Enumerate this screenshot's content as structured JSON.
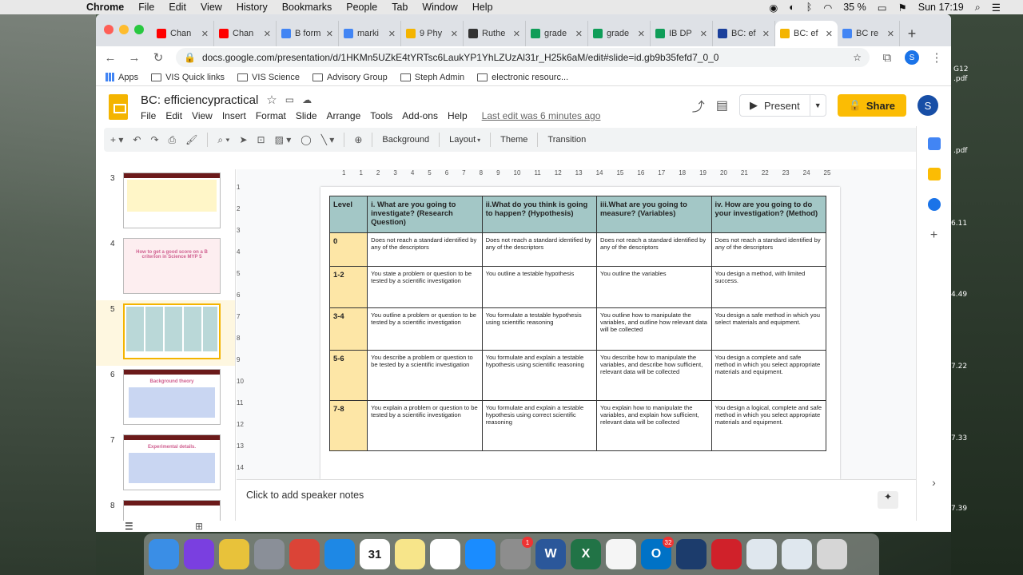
{
  "menubar": {
    "app": "Chrome",
    "items": [
      "File",
      "Edit",
      "View",
      "History",
      "Bookmarks",
      "People",
      "Tab",
      "Window",
      "Help"
    ],
    "battery": "35 %",
    "clock": "Sun 17:19"
  },
  "tabs": [
    {
      "title": "Chan",
      "color": "#ff0000"
    },
    {
      "title": "Chan",
      "color": "#ff0000"
    },
    {
      "title": "B form",
      "color": "#4285f4"
    },
    {
      "title": "marki",
      "color": "#4285f4"
    },
    {
      "title": "9 Phy",
      "color": "#f4b400"
    },
    {
      "title": "Ruthe",
      "color": "#333333"
    },
    {
      "title": "grade",
      "color": "#0f9d58"
    },
    {
      "title": "grade",
      "color": "#0f9d58"
    },
    {
      "title": "IB DP",
      "color": "#0f9d58"
    },
    {
      "title": "BC: ef",
      "color": "#1a3f9b"
    },
    {
      "title": "BC: ef",
      "color": "#f4b400",
      "active": true
    },
    {
      "title": "BC re",
      "color": "#4285f4"
    }
  ],
  "address": {
    "url": "docs.google.com/presentation/d/1HKMn5UZkE4tYRTsc6LaukYP1YhLZUzAl31r_H25k6aM/edit#slide=id.gb9b35fefd7_0_0",
    "profile_initial": "S"
  },
  "bookmarks": [
    "Apps",
    "VIS Quick links",
    "VIS Science",
    "Advisory Group",
    "Steph Admin",
    "electronic resourc..."
  ],
  "doc": {
    "title": "BC: efficiencypractical",
    "menu": [
      "File",
      "Edit",
      "View",
      "Insert",
      "Format",
      "Slide",
      "Arrange",
      "Tools",
      "Add-ons",
      "Help"
    ],
    "last_edit": "Last edit was 6 minutes ago",
    "present_label": "Present",
    "share_label": "Share",
    "user_initial": "S"
  },
  "toolbar": {
    "background": "Background",
    "layout": "Layout",
    "theme": "Theme",
    "transition": "Transition"
  },
  "ruler": {
    "h": [
      "1",
      "1",
      "2",
      "3",
      "4",
      "5",
      "6",
      "7",
      "8",
      "9",
      "10",
      "11",
      "12",
      "13",
      "14",
      "15",
      "16",
      "17",
      "18",
      "19",
      "20",
      "21",
      "22",
      "23",
      "24",
      "25"
    ],
    "v": [
      "1",
      "2",
      "3",
      "4",
      "5",
      "6",
      "7",
      "8",
      "9",
      "10",
      "11",
      "12",
      "13",
      "14"
    ]
  },
  "filmstrip": [
    {
      "num": "3",
      "kind": "yellow"
    },
    {
      "num": "4",
      "kind": "title",
      "text": "How to get a good score on a B criterion in Science MYP 5"
    },
    {
      "num": "5",
      "kind": "grid",
      "selected": true
    },
    {
      "num": "6",
      "kind": "box",
      "text": "Background theory"
    },
    {
      "num": "7",
      "kind": "box",
      "text": "Experimental details."
    },
    {
      "num": "8",
      "kind": "box"
    }
  ],
  "table": {
    "headers": [
      "Level",
      "i. What are you going to investigate? (Research Question)",
      "ii.What do you think is going to happen? (Hypothesis)",
      "iii.What are you going to measure? (Variables)",
      "iv. How are you going to do your investigation? (Method)"
    ],
    "rows": [
      [
        "0",
        "Does not reach a standard identified by any of the descriptors",
        "Does not reach a standard identified by any of the descriptors",
        "Does not reach a standard identified by any of the descriptors",
        "Does not reach a standard identified by any of the descriptors"
      ],
      [
        "1-2",
        "You state a problem or question to be tested by a scientific investigation",
        "You outline a testable hypothesis",
        "You outline the variables",
        "You design a method, with limited success."
      ],
      [
        "3-4",
        "You outline a problem or question to be tested by a scientific investigation",
        "You formulate a testable hypothesis using scientific reasoning",
        "You outline how to manipulate the variables, and outline how relevant data will be collected",
        "You design a safe method in which you select materials and equipment."
      ],
      [
        "5-6",
        "You describe a problem or question to be tested by a scientific investigation",
        "You formulate and explain a testable hypothesis using scientific reasoning",
        "You describe how to manipulate the variables, and describe how sufficient, relevant data will be collected",
        "You design a complete and safe method in which you select appropriate materials and equipment."
      ],
      [
        "7-8",
        "You explain a problem or question to be tested by a scientific investigation",
        "You formulate and explain a testable hypothesis using correct scientific reasoning",
        "You explain how to manipulate the variables, and explain how sufficient, relevant data will be collected",
        "You design a logical, complete and safe method in which you select appropriate materials and equipment."
      ]
    ]
  },
  "notes_placeholder": "Click to add speaker notes",
  "desktop_labels": [
    "G12",
    ".pdf",
    ".pdf",
    "6.11",
    "4.49",
    "7.22",
    "7.33",
    "7.39"
  ],
  "dock": [
    {
      "name": "finder",
      "color": "#3a8ee6"
    },
    {
      "name": "siri",
      "color": "#7a3fe0"
    },
    {
      "name": "photos",
      "color": "#e8c23a"
    },
    {
      "name": "launchpad",
      "color": "#8a8f98"
    },
    {
      "name": "chrome",
      "color": "#db4437"
    },
    {
      "name": "safari",
      "color": "#1e88e5"
    },
    {
      "name": "calendar",
      "color": "#ffffff",
      "label": "31"
    },
    {
      "name": "notes",
      "color": "#f7e58a"
    },
    {
      "name": "reminders",
      "color": "#ffffff"
    },
    {
      "name": "app-store",
      "color": "#1a8cff"
    },
    {
      "name": "system-preferences",
      "color": "#8d8d8d",
      "badge": "1"
    },
    {
      "name": "word",
      "color": "#2b579a",
      "label": "W"
    },
    {
      "name": "excel",
      "color": "#217346",
      "label": "X"
    },
    {
      "name": "itunes",
      "color": "#f5f5f5"
    },
    {
      "name": "outlook",
      "color": "#0072c6",
      "label": "O",
      "badge": "32"
    },
    {
      "name": "quicktime",
      "color": "#1c3c6c"
    },
    {
      "name": "photo-booth",
      "color": "#d0212a"
    },
    {
      "name": "preview",
      "color": "#dfe7ee"
    },
    {
      "name": "screenshot",
      "color": "#dfe7ee"
    },
    {
      "name": "trash",
      "color": "#d6d6d6"
    }
  ]
}
